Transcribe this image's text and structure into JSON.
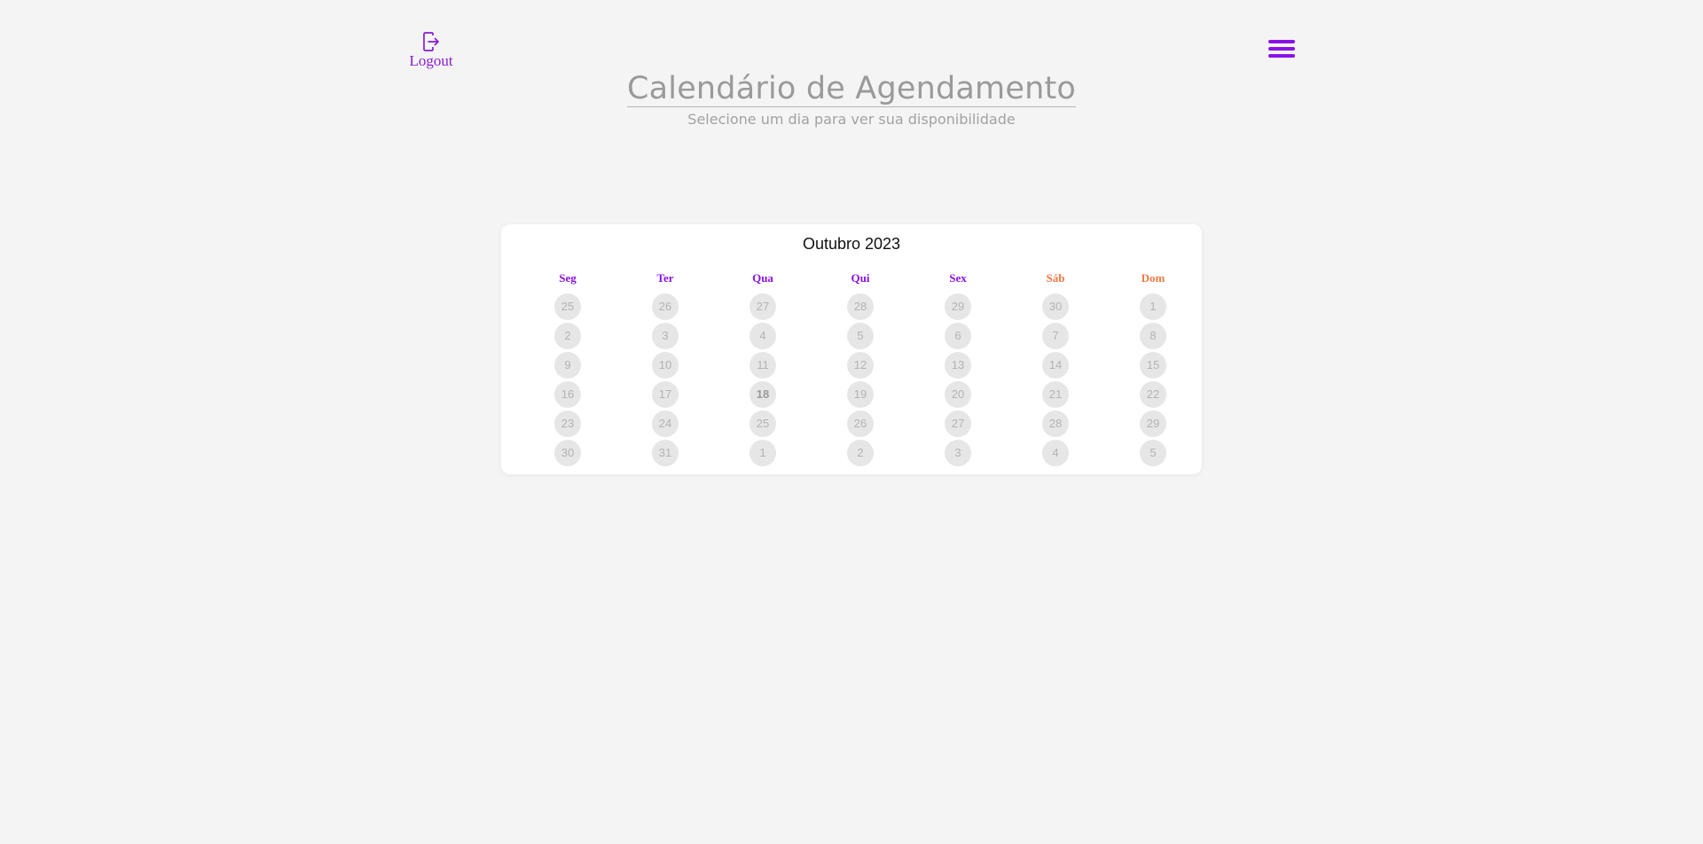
{
  "header": {
    "logout_label": "Logout",
    "title": "Calendário de Agendamento",
    "subtitle": "Selecione um dia para ver sua disponibilidade"
  },
  "calendar": {
    "month": "Outubro 2023",
    "weekdays": [
      "Seg",
      "Ter",
      "Qua",
      "Qui",
      "Sex",
      "Sáb",
      "Dom"
    ],
    "weeks": [
      [
        "25",
        "26",
        "27",
        "28",
        "29",
        "30",
        "1"
      ],
      [
        "2",
        "3",
        "4",
        "5",
        "6",
        "7",
        "8"
      ],
      [
        "9",
        "10",
        "11",
        "12",
        "13",
        "14",
        "15"
      ],
      [
        "16",
        "17",
        "18",
        "19",
        "20",
        "21",
        "22"
      ],
      [
        "23",
        "24",
        "25",
        "26",
        "27",
        "28",
        "29"
      ],
      [
        "30",
        "31",
        "1",
        "2",
        "3",
        "4",
        "5"
      ]
    ]
  },
  "colors": {
    "accent": "#8a12e6",
    "weekend": "#f07a43",
    "day_bg": "#e6e6e6",
    "page_bg": "#f4f4f4"
  },
  "icons": {
    "logout": "logout-icon",
    "menu": "hamburger-menu-icon"
  }
}
